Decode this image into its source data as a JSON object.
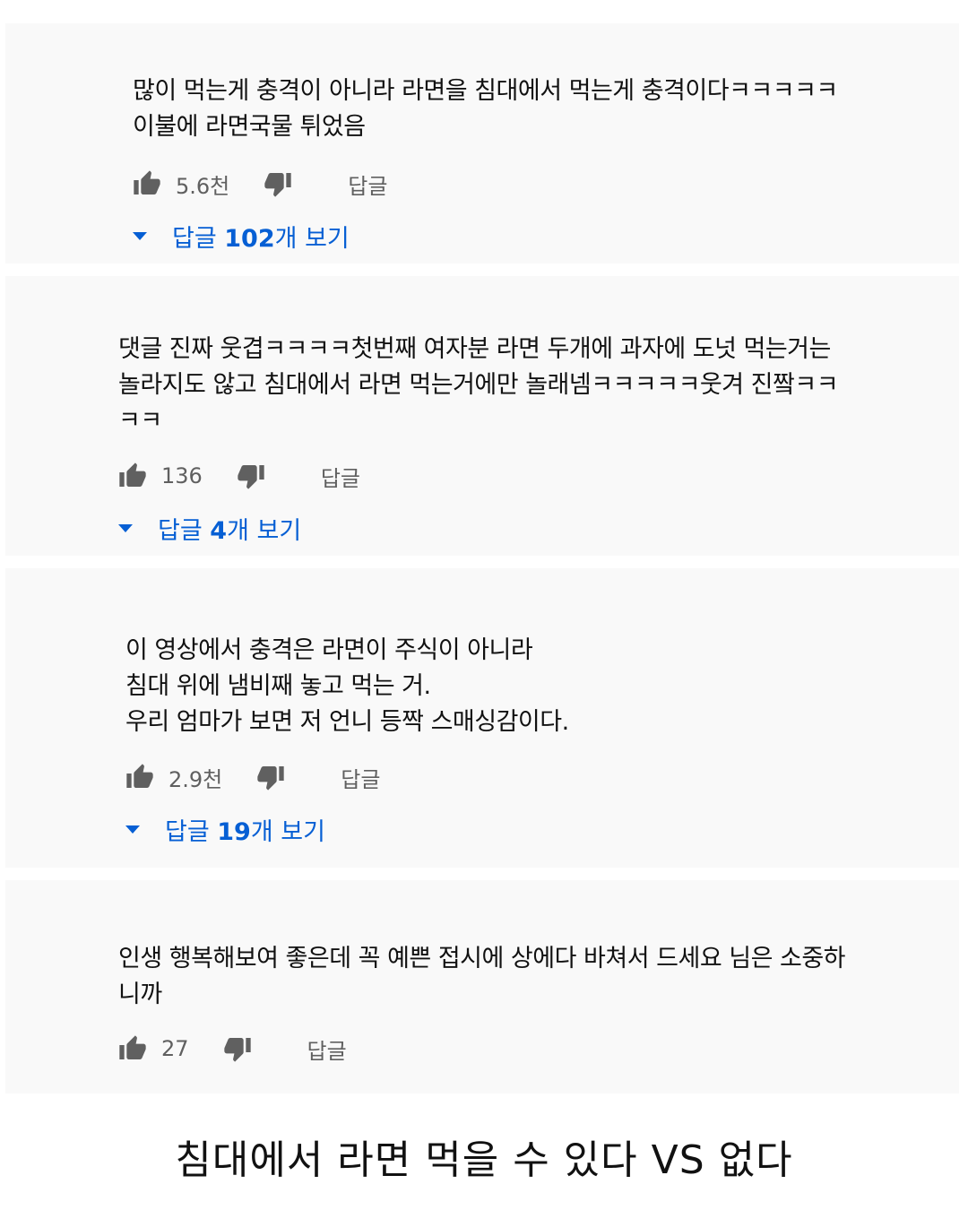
{
  "comments": [
    {
      "text": "많이 먹는게 충격이 아니라 라면을 침대에서 먹는게 충격이다ㅋㅋㅋㅋㅋ\n이불에 라면국물 튀었음",
      "likes": "5.6천",
      "reply_label": "답글",
      "view_replies": {
        "prefix": "답글 ",
        "count": "102",
        "suffix": "개 보기"
      }
    },
    {
      "text": "댓글 진짜 웃겹ㅋㅋㅋㅋ첫번째 여자분 라면 두개에 과자에 도넛 먹는거는\n놀라지도 않고 침대에서 라면 먹는거에만 놀래넴ㅋㅋㅋㅋㅋ웃겨 진짴ㅋㅋ\nㅋㅋ",
      "likes": "136",
      "reply_label": "답글",
      "view_replies": {
        "prefix": "답글 ",
        "count": "4",
        "suffix": "개 보기"
      }
    },
    {
      "text": "이 영상에서 충격은 라면이 주식이 아니라\n침대 위에 냄비째 놓고 먹는 거.\n우리 엄마가 보면 저 언니 등짝 스매싱감이다.",
      "likes": "2.9천",
      "reply_label": "답글",
      "view_replies": {
        "prefix": "답글 ",
        "count": "19",
        "suffix": "개 보기"
      }
    },
    {
      "text": "인생 행복해보여 좋은데 꼭 예쁜 접시에 상에다 바쳐서 드세요 님은 소중하\n니까",
      "likes": "27",
      "reply_label": "답글"
    }
  ],
  "footer": {
    "title": "침대에서 라면 먹을 수 있다 VS 없다"
  },
  "colors": {
    "link": "#065fd4",
    "meta": "#606060",
    "card_bg": "#f9f9f9"
  },
  "icons": {
    "like": "thumbs-up-icon",
    "dislike": "thumbs-down-icon",
    "expand": "caret-down-icon"
  }
}
